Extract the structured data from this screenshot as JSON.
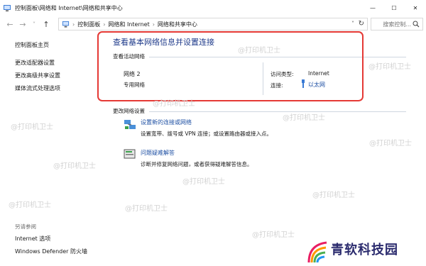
{
  "window": {
    "title": "控制面板\\网络和 Internet\\网络和共享中心",
    "minimize_label": "—",
    "maximize_label": "☐",
    "close_label": "✕"
  },
  "nav": {
    "back": "←",
    "forward": "→",
    "history": "˅",
    "up": "↑",
    "breadcrumbs": [
      "控制面板",
      "网络和 Internet",
      "网络和共享中心"
    ],
    "breadcrumb_sep": "›",
    "dropdown": "˅",
    "refresh": "↻"
  },
  "search": {
    "placeholder": "搜索控制..."
  },
  "sidebar": {
    "home": "控制面板主页",
    "items": [
      "更改适配器设置",
      "更改高级共享设置",
      "媒体流式处理选项"
    ],
    "see_also_heading": "另请参阅",
    "see_also": [
      "Internet 选项",
      "Windows Defender 防火墙"
    ]
  },
  "main": {
    "title": "查看基本网络信息并设置连接",
    "active_heading": "查看活动网络",
    "network_name": "网络 2",
    "network_type": "专用网络",
    "access_type_label": "访问类型:",
    "access_type_value": "Internet",
    "connection_label": "连接:",
    "connection_value": "以太网",
    "change_heading": "更改网络设置",
    "tasks": [
      {
        "title": "设置新的连接或网络",
        "desc": "设置宽带、拨号或 VPN 连接；或设置路由器或接入点。",
        "icon": "network-setup-icon"
      },
      {
        "title": "问题疑难解答",
        "desc": "诊断并修复网络问题，或者获得疑难解答信息。",
        "icon": "troubleshoot-icon"
      }
    ]
  },
  "watermark": "@打印机卫士",
  "brand": {
    "name": "青软科技园"
  },
  "colors": {
    "highlight": "#e53935",
    "link": "#1d4fa3",
    "title": "#1e3a8a"
  }
}
